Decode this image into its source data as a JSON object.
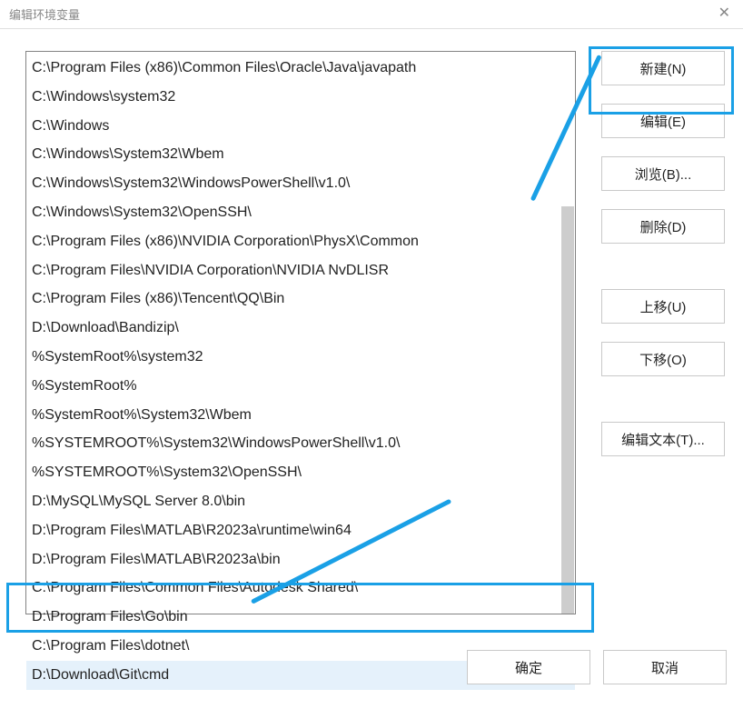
{
  "window": {
    "title": "编辑环境变量"
  },
  "list": {
    "items": [
      "C:\\Program Files (x86)\\Common Files\\Oracle\\Java\\javapath",
      "C:\\Windows\\system32",
      "C:\\Windows",
      "C:\\Windows\\System32\\Wbem",
      "C:\\Windows\\System32\\WindowsPowerShell\\v1.0\\",
      "C:\\Windows\\System32\\OpenSSH\\",
      "C:\\Program Files (x86)\\NVIDIA Corporation\\PhysX\\Common",
      "C:\\Program Files\\NVIDIA Corporation\\NVIDIA NvDLISR",
      "C:\\Program Files (x86)\\Tencent\\QQ\\Bin",
      "D:\\Download\\Bandizip\\",
      "%SystemRoot%\\system32",
      "%SystemRoot%",
      "%SystemRoot%\\System32\\Wbem",
      "%SYSTEMROOT%\\System32\\WindowsPowerShell\\v1.0\\",
      "%SYSTEMROOT%\\System32\\OpenSSH\\",
      "D:\\MySQL\\MySQL Server 8.0\\bin",
      "D:\\Program Files\\MATLAB\\R2023a\\runtime\\win64",
      "D:\\Program Files\\MATLAB\\R2023a\\bin",
      "C:\\Program Files\\Common Files\\Autodesk Shared\\",
      "D:\\Program Files\\Go\\bin",
      "C:\\Program Files\\dotnet\\",
      "D:\\Download\\Git\\cmd"
    ],
    "selected_index": 21
  },
  "buttons": {
    "new": "新建(N)",
    "edit": "编辑(E)",
    "browse": "浏览(B)...",
    "delete": "删除(D)",
    "moveup": "上移(U)",
    "movedown": "下移(O)",
    "edittext": "编辑文本(T)...",
    "ok": "确定",
    "cancel": "取消"
  }
}
